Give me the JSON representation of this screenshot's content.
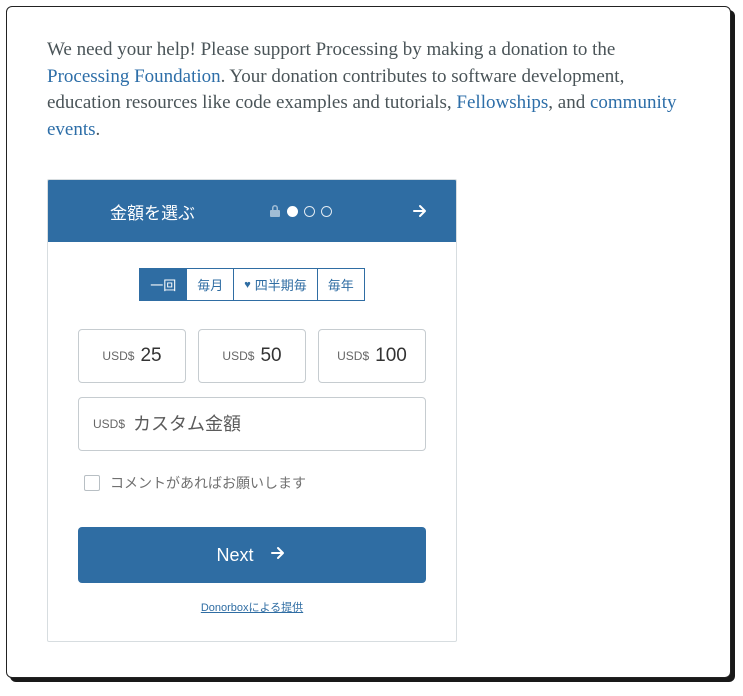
{
  "intro": {
    "t1": "We need your help! Please support Processing by making a donation to the ",
    "link1": "Processing Foundation",
    "t2": ". Your donation contributes to software development, education resources like code examples and tutorials, ",
    "link2": "Fellowships",
    "t3": ", and ",
    "link3": "community events",
    "t4": "."
  },
  "donorbox": {
    "title": "金額を選ぶ",
    "frequency": {
      "once": "一回",
      "monthly": "毎月",
      "quarterly": "四半期毎",
      "yearly": "毎年"
    },
    "currency": "USD$",
    "amounts": {
      "a": "25",
      "b": "50",
      "c": "100"
    },
    "custom_placeholder": "カスタム金額",
    "comment_label": "コメントがあればお願いします",
    "next_label": "Next",
    "provider_text": "Donorboxによる提供"
  }
}
